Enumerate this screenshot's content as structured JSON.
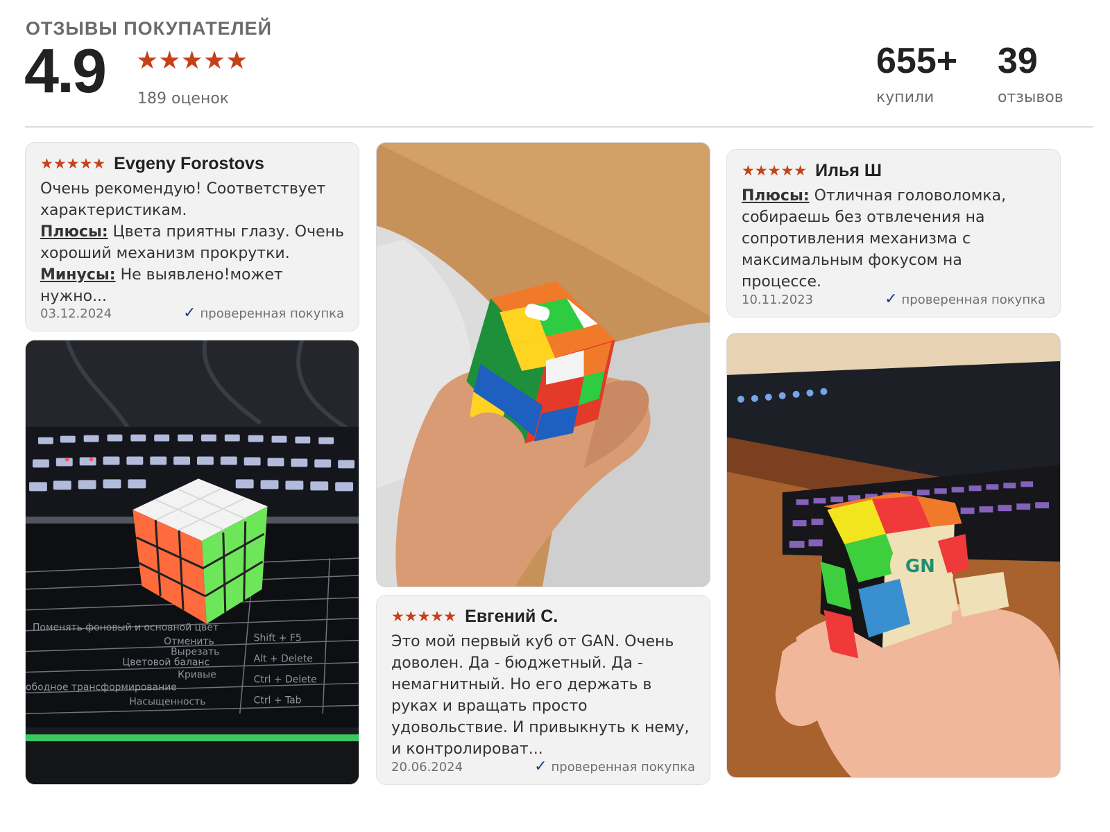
{
  "header": {
    "title": "ОТЗЫВЫ ПОКУПАТЕЛЕЙ",
    "rating": "4.9",
    "stars": "★★★★★",
    "ratings_count": "189 оценок",
    "bought_value": "655+",
    "bought_label": "купили",
    "reviews_value": "39",
    "reviews_label": "отзывов"
  },
  "reviews": [
    {
      "stars": "★★★★★",
      "author": "Evgeny Forostovs",
      "intro": "Очень рекомендую! Соответствует характеристикам.",
      "pros_label": "Плюсы:",
      "pros": " Цвета приятны глазу. Очень хороший механизм прокрутки.",
      "cons_label": "Минусы:",
      "cons": " Не выявлено!может нужно...",
      "date": "03.12.2024",
      "verified": "проверенная покупка"
    },
    {
      "stars": "★★★★★",
      "author": "Евгений С.",
      "text": "Это мой первый куб от GAN. Очень доволен. Да - бюджетный. Да - немагнитный. Но его держать в руках и вращать просто удовольствие. И привыкнуть к нему, и контролироват...",
      "date": "20.06.2024",
      "verified": "проверенная покупка"
    },
    {
      "stars": "★★★★★",
      "author": "Илья Ш",
      "pros_label": "Плюсы:",
      "pros": " Отличная головоломка, собираешь без отвлечения на сопротивления механизма с максимальным фокусом на процессе.",
      "date": "10.11.2023",
      "verified": "проверенная покупка"
    }
  ],
  "colors": {
    "star": "#c5411a",
    "check": "#1f3a8a"
  }
}
